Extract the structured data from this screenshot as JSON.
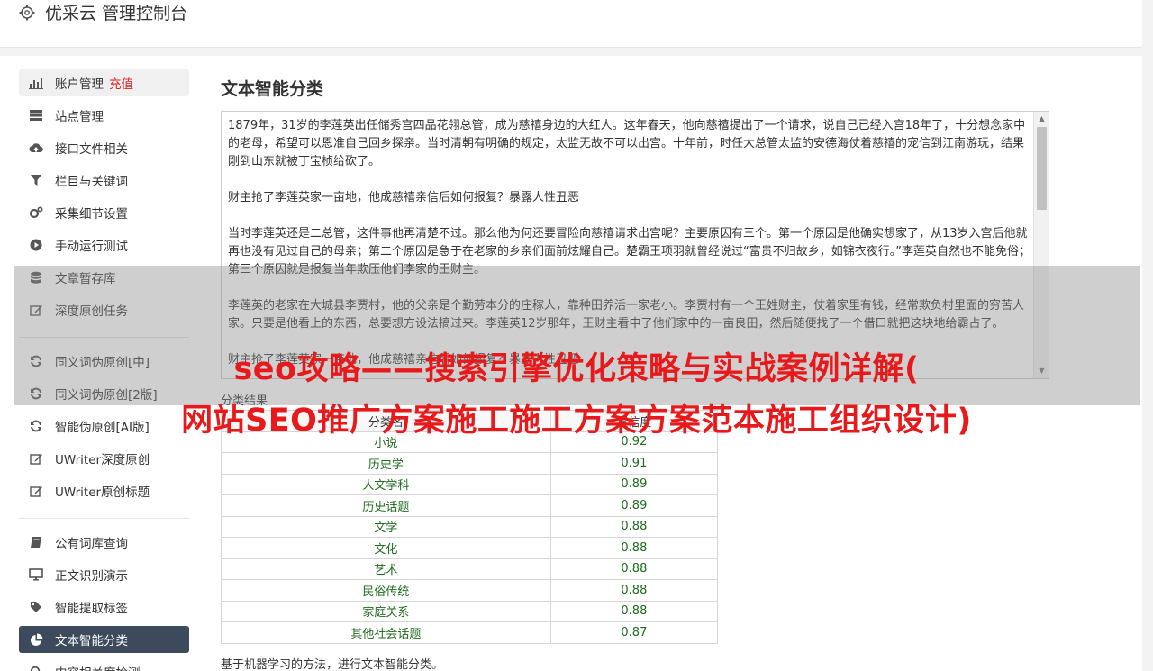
{
  "header": {
    "title": "优采云 管理控制台",
    "logo_icon": "gear-icon"
  },
  "sidebar": {
    "items": [
      {
        "label": "账户管理",
        "extra": "充值",
        "icon": "bar-chart-icon"
      },
      {
        "label": "站点管理",
        "icon": "server-icon"
      },
      {
        "label": "接口文件相关",
        "icon": "cloud-upload-icon"
      },
      {
        "label": "栏目与关键词",
        "icon": "filter-icon"
      },
      {
        "label": "采集细节设置",
        "icon": "cogs-icon"
      },
      {
        "label": "手动运行测试",
        "icon": "play-circle-icon"
      },
      {
        "label": "文章暂存库",
        "icon": "database-icon"
      },
      {
        "label": "深度原创任务",
        "icon": "edit-icon"
      },
      {
        "label": "同义词伪原创[中]",
        "icon": "refresh-icon"
      },
      {
        "label": "同义词伪原创[2版]",
        "icon": "refresh-icon"
      },
      {
        "label": "智能伪原创[AI版]",
        "icon": "refresh-icon"
      },
      {
        "label": "UWriter深度原创",
        "icon": "edit-icon"
      },
      {
        "label": "UWriter原创标题",
        "icon": "edit-icon"
      },
      {
        "label": "公有词库查询",
        "icon": "book-icon"
      },
      {
        "label": "正文识别演示",
        "icon": "monitor-icon"
      },
      {
        "label": "智能提取标签",
        "icon": "tag-icon"
      },
      {
        "label": "文本智能分类",
        "icon": "pie-chart-icon"
      },
      {
        "label": "内容相关度检测",
        "icon": "search-icon"
      }
    ]
  },
  "main": {
    "title": "文本智能分类",
    "text_paragraphs": [
      "1879年，31岁的李莲英出任储秀宫四品花翎总管，成为慈禧身边的大红人。这年春天，他向慈禧提出了一个请求，说自己已经入宫18年了，十分想念家中的老母，希望可以恩准自己回乡探亲。当时清朝有明确的规定，太监无故不可以出宫。十年前，时任大总管太监的安德海仗着慈禧的宠信到江南游玩，结果刚到山东就被丁宝桢给砍了。",
      "财主抢了李莲英家一亩地，他成慈禧亲信后如何报复？暴露人性丑恶",
      "当时李莲英还是二总管，这件事他再清楚不过。那么他为何还要冒险向慈禧请求出宫呢？主要原因有三个。第一个原因是他确实想家了，从13岁入宫后他就再也没有见过自己的母亲；第二个原因是急于在老家的乡亲们面前炫耀自己。楚霸王项羽就曾经说过“富贵不归故乡，如锦衣夜行。”李莲英自然也不能免俗；第三个原因就是报复当年欺压他们李家的王财主。",
      "李莲英的老家在大城县李贾村，他的父亲是个勤劳本分的庄稼人，靠种田养活一家老小。李贾村有一个王姓财主，仗着家里有钱，经常欺负村里面的穷苦人家。只要是他看上的东西，总要想方设法搞过来。李莲英12岁那年，王财主看中了他们家中的一亩良田，然后随便找了一个借口就把这块地给霸占了。",
      "财主抢了李莲英家一亩地，他成慈禧亲信后如何报复？暴露人性丑恶"
    ],
    "result_label": "分类结果",
    "table": {
      "headers": [
        "分类名",
        "置信度"
      ],
      "rows": [
        [
          "小说",
          "0.92"
        ],
        [
          "历史学",
          "0.91"
        ],
        [
          "人文学科",
          "0.89"
        ],
        [
          "历史话题",
          "0.89"
        ],
        [
          "文学",
          "0.88"
        ],
        [
          "文化",
          "0.88"
        ],
        [
          "艺术",
          "0.88"
        ],
        [
          "民俗传统",
          "0.88"
        ],
        [
          "家庭关系",
          "0.88"
        ],
        [
          "其他社会话题",
          "0.87"
        ]
      ]
    },
    "footnote": "基于机器学习的方法，进行文本智能分类。"
  },
  "overlay": {
    "line1": "seo攻略——搜索引擎优化策略与实战案例详解(",
    "line2": "网站SEO推广方案施工施工方案方案范本施工组织设计)"
  }
}
